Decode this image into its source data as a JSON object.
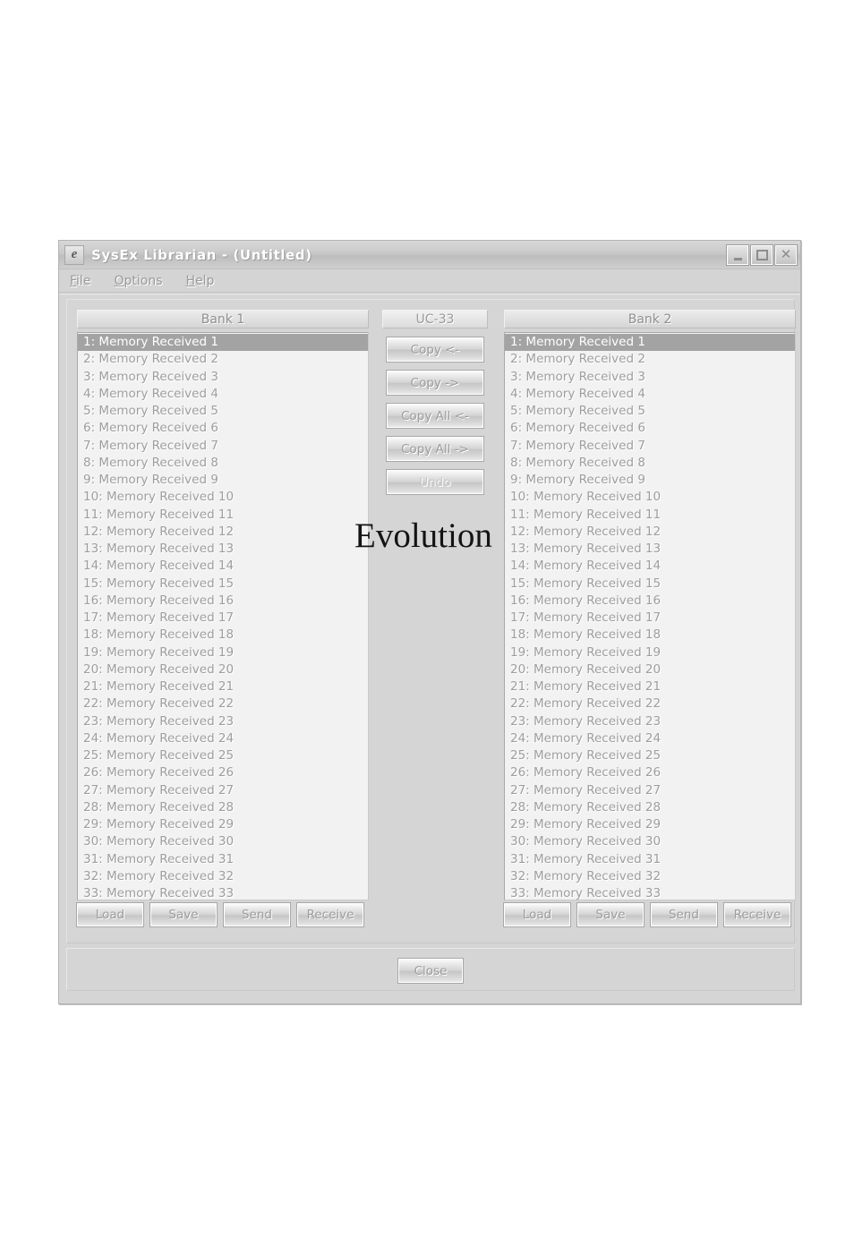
{
  "window": {
    "icon": "evolution-e-icon",
    "title": "SysEx Librarian  -  (Untitled)",
    "buttons": {
      "minimize": "_",
      "maximize": "□",
      "close": "✕"
    }
  },
  "menu": [
    {
      "mnemonic": "F",
      "rest": "ile"
    },
    {
      "mnemonic": "O",
      "rest": "ptions"
    },
    {
      "mnemonic": "H",
      "rest": "elp"
    }
  ],
  "banks": {
    "left": {
      "title": "Bank 1",
      "selected_index": 0,
      "items": [
        "1: Memory Received 1",
        "2: Memory Received 2",
        "3: Memory Received 3",
        "4: Memory Received 4",
        "5: Memory Received 5",
        "6: Memory Received 6",
        "7: Memory Received 7",
        "8: Memory Received 8",
        "9: Memory Received 9",
        "10: Memory Received 10",
        "11: Memory Received 11",
        "12: Memory Received 12",
        "13: Memory Received 13",
        "14: Memory Received 14",
        "15: Memory Received 15",
        "16: Memory Received 16",
        "17: Memory Received 17",
        "18: Memory Received 18",
        "19: Memory Received 19",
        "20: Memory Received 20",
        "21: Memory Received 21",
        "22: Memory Received 22",
        "23: Memory Received 23",
        "24: Memory Received 24",
        "25: Memory Received 25",
        "26: Memory Received 26",
        "27: Memory Received 27",
        "28: Memory Received 28",
        "29: Memory Received 29",
        "30: Memory Received 30",
        "31: Memory Received 31",
        "32: Memory Received 32",
        "33: Memory Received 33"
      ],
      "actions": [
        "Load",
        "Save",
        "Send",
        "Receive"
      ]
    },
    "right": {
      "title": "Bank 2",
      "selected_index": 0,
      "items": [
        "1: Memory Received 1",
        "2: Memory Received 2",
        "3: Memory Received 3",
        "4: Memory Received 4",
        "5: Memory Received 5",
        "6: Memory Received 6",
        "7: Memory Received 7",
        "8: Memory Received 8",
        "9: Memory Received 9",
        "10: Memory Received 10",
        "11: Memory Received 11",
        "12: Memory Received 12",
        "13: Memory Received 13",
        "14: Memory Received 14",
        "15: Memory Received 15",
        "16: Memory Received 16",
        "17: Memory Received 17",
        "18: Memory Received 18",
        "19: Memory Received 19",
        "20: Memory Received 20",
        "21: Memory Received 21",
        "22: Memory Received 22",
        "23: Memory Received 23",
        "24: Memory Received 24",
        "25: Memory Received 25",
        "26: Memory Received 26",
        "27: Memory Received 27",
        "28: Memory Received 28",
        "29: Memory Received 29",
        "30: Memory Received 30",
        "31: Memory Received 31",
        "32: Memory Received 32",
        "33: Memory Received 33"
      ],
      "actions": [
        "Load",
        "Save",
        "Send",
        "Receive"
      ]
    }
  },
  "center": {
    "device": "UC-33",
    "buttons": [
      {
        "label": "Copy <-",
        "name": "copy-left-button",
        "disabled": false
      },
      {
        "label": "Copy ->",
        "name": "copy-right-button",
        "disabled": false
      },
      {
        "label": "Copy All <-",
        "name": "copy-all-left-button",
        "disabled": false
      },
      {
        "label": "Copy All ->",
        "name": "copy-all-right-button",
        "disabled": false
      },
      {
        "label": "Undo",
        "name": "undo-button",
        "disabled": true
      }
    ]
  },
  "footer": {
    "close_label": "Close"
  },
  "watermark": {
    "text": "Evolution"
  },
  "colors": {
    "page_background": "#ffffff",
    "window_face": "#d2d2d2",
    "list_background": "#f2f2f2",
    "list_text": "#9e9e9e",
    "selection_background": "#a3a3a3",
    "selection_text": "#ffffff",
    "title_text": "#ffffff",
    "disabled_text": "#cacaca"
  }
}
